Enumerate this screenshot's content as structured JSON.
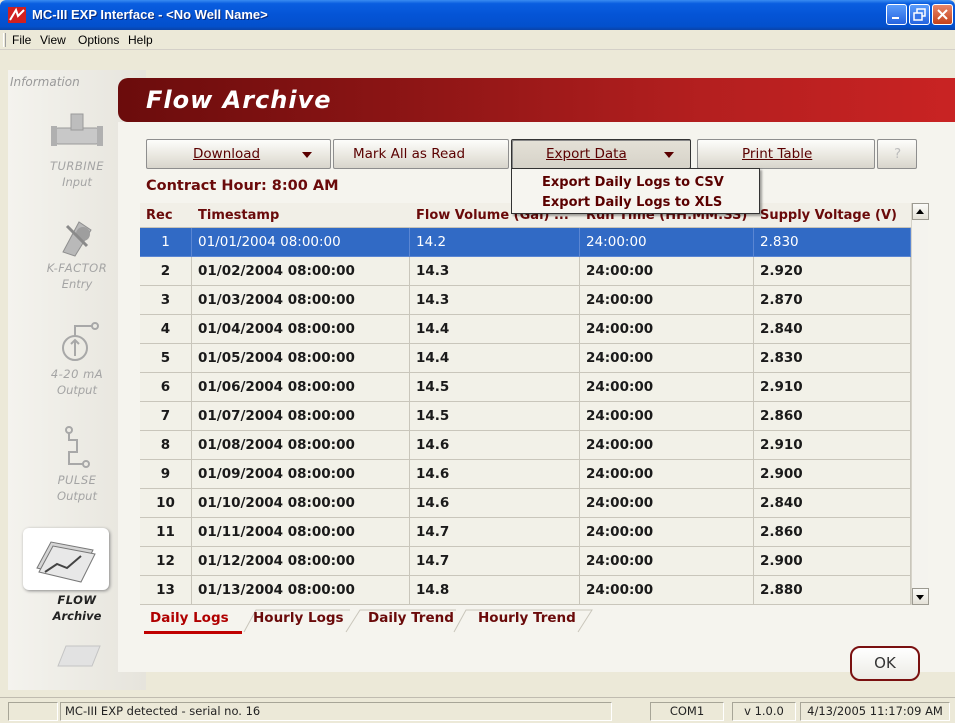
{
  "window": {
    "title": "MC-III EXP Interface - <No Well Name>",
    "controls": [
      "minimize-icon",
      "restore-icon",
      "close-icon"
    ]
  },
  "menubar": {
    "items": [
      "File",
      "View",
      "Options",
      "Help"
    ]
  },
  "sidebar": {
    "section_label": "Information",
    "items": [
      {
        "line1": "TURBINE",
        "line2": "Input",
        "icon": "turbine-icon"
      },
      {
        "line1": "K-FACTOR",
        "line2": "Entry",
        "icon": "kfactor-icon"
      },
      {
        "line1": "4-20 mA",
        "line2": "Output",
        "icon": "analog-output-icon"
      },
      {
        "line1": "PULSE",
        "line2": "Output",
        "icon": "pulse-output-icon"
      },
      {
        "line1": "FLOW",
        "line2": "Archive",
        "icon": "flow-archive-icon",
        "active": true
      }
    ]
  },
  "header": {
    "title": "Flow Archive"
  },
  "toolbar": {
    "download": "Download",
    "mark_all_read": "Mark All as Read",
    "export_data": "Export Data",
    "print_table": "Print Table",
    "help": "?"
  },
  "export_menu": {
    "items": [
      "Export Daily Logs to CSV",
      "Export Daily Logs to XLS"
    ]
  },
  "contract_hour": "Contract Hour: 8:00 AM",
  "table": {
    "columns": [
      "Rec",
      "Timestamp",
      "Flow Volume (Gal) ...",
      "Run Time (HH:MM:SS)",
      "Supply Voltage (V)"
    ],
    "rows": [
      [
        "1",
        "01/01/2004 08:00:00",
        "14.2",
        "24:00:00",
        "2.830"
      ],
      [
        "2",
        "01/02/2004 08:00:00",
        "14.3",
        "24:00:00",
        "2.920"
      ],
      [
        "3",
        "01/03/2004 08:00:00",
        "14.3",
        "24:00:00",
        "2.870"
      ],
      [
        "4",
        "01/04/2004 08:00:00",
        "14.4",
        "24:00:00",
        "2.840"
      ],
      [
        "5",
        "01/05/2004 08:00:00",
        "14.4",
        "24:00:00",
        "2.830"
      ],
      [
        "6",
        "01/06/2004 08:00:00",
        "14.5",
        "24:00:00",
        "2.910"
      ],
      [
        "7",
        "01/07/2004 08:00:00",
        "14.5",
        "24:00:00",
        "2.860"
      ],
      [
        "8",
        "01/08/2004 08:00:00",
        "14.6",
        "24:00:00",
        "2.910"
      ],
      [
        "9",
        "01/09/2004 08:00:00",
        "14.6",
        "24:00:00",
        "2.900"
      ],
      [
        "10",
        "01/10/2004 08:00:00",
        "14.6",
        "24:00:00",
        "2.840"
      ],
      [
        "11",
        "01/11/2004 08:00:00",
        "14.7",
        "24:00:00",
        "2.860"
      ],
      [
        "12",
        "01/12/2004 08:00:00",
        "14.7",
        "24:00:00",
        "2.900"
      ],
      [
        "13",
        "01/13/2004 08:00:00",
        "14.8",
        "24:00:00",
        "2.880"
      ]
    ],
    "selected_row": 0
  },
  "tabs": [
    "Daily Logs",
    "Hourly Logs",
    "Daily Trend",
    "Hourly Trend"
  ],
  "ok_button": "OK",
  "statusbar": {
    "message": "MC-III EXP detected - serial no. 16",
    "port": "COM1",
    "version": "v 1.0.0",
    "datetime": "4/13/2005 11:17:09 AM"
  },
  "colors": {
    "accent": "#8d1515",
    "selection": "#316ac5",
    "title_bar": "#0454d6"
  }
}
